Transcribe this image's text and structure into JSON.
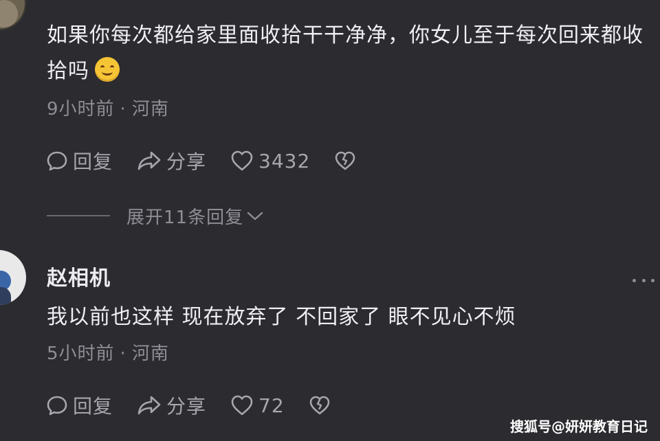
{
  "comments": [
    {
      "author": "",
      "text": "如果你每次都给家里面收拾干干净净，你女儿至于每次回来都收拾吗",
      "emoji": "smiling-face-emoji",
      "time": "9小时前",
      "location": "河南",
      "reply_label": "回复",
      "share_label": "分享",
      "likes": "3432"
    },
    {
      "author": "赵相机",
      "text": "我以前也这样 现在放弃了 不回家了 眼不见心不烦",
      "time": "5小时前",
      "location": "河南",
      "reply_label": "回复",
      "share_label": "分享",
      "likes": "72"
    }
  ],
  "expand_replies_label": "展开11条回复",
  "watermark": "搜狐号@妍妍教育日记",
  "colors": {
    "background": "#2c2b30",
    "text_primary": "#f0eff3",
    "text_secondary": "#8f8e95",
    "icon": "#a7a6ad"
  }
}
